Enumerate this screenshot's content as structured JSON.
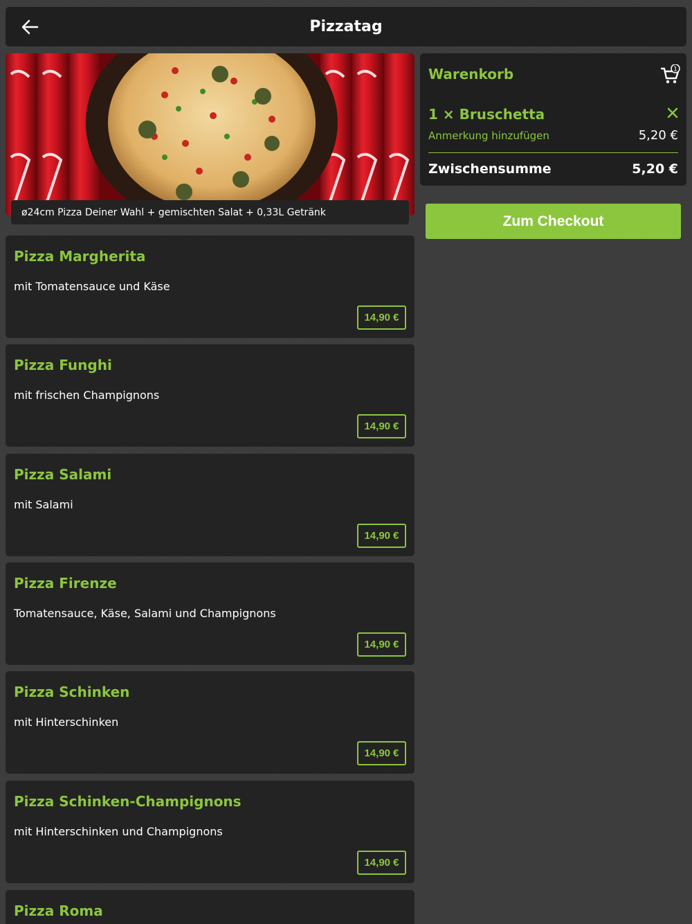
{
  "header": {
    "title": "Pizzatag",
    "back_icon": "arrow-left-icon"
  },
  "hero": {
    "caption": "ø24cm Pizza Deiner Wahl + gemischten Salat + 0,33L Getränk"
  },
  "products": [
    {
      "name": "Pizza Margherita",
      "description": "mit Tomatensauce und Käse",
      "price": "14,90 €"
    },
    {
      "name": "Pizza Funghi",
      "description": "mit frischen Champignons",
      "price": "14,90 €"
    },
    {
      "name": "Pizza Salami",
      "description": "mit Salami",
      "price": "14,90 €"
    },
    {
      "name": "Pizza Firenze",
      "description": "Tomatensauce, Käse, Salami und Champignons",
      "price": "14,90 €"
    },
    {
      "name": "Pizza Schinken",
      "description": "mit Hinterschinken",
      "price": "14,90 €"
    },
    {
      "name": "Pizza Schinken-Champignons",
      "description": "mit Hinterschinken und Champignons",
      "price": "14,90 €"
    },
    {
      "name": "Pizza Roma",
      "description": "",
      "price": ""
    }
  ],
  "cart": {
    "title": "Warenkorb",
    "count": "1",
    "item": {
      "quantity_name": "1 × Bruschetta",
      "note_link": "Anmerkung hinzufügen",
      "price": "5,20 €"
    },
    "subtotal_label": "Zwischensumme",
    "subtotal_value": "5,20 €",
    "checkout_label": "Zum Checkout"
  },
  "colors": {
    "accent": "#8cc63f",
    "card": "#232323",
    "background": "#3c3c3c"
  }
}
